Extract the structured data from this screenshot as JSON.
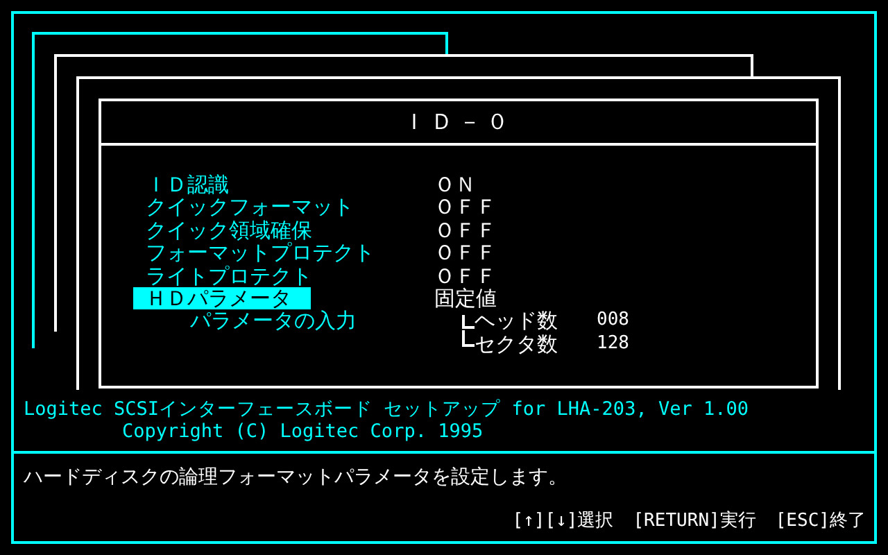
{
  "dialog": {
    "title": "ＩＤ－０",
    "settings": [
      {
        "label": "ＩＤ認識",
        "value": "ＯＮ",
        "selected": false
      },
      {
        "label": "クイックフォーマット",
        "value": "ＯＦＦ",
        "selected": false
      },
      {
        "label": "クイック領域確保",
        "value": "ＯＦＦ",
        "selected": false
      },
      {
        "label": "フォーマットプロテクト",
        "value": "ＯＦＦ",
        "selected": false
      },
      {
        "label": "ライトプロテクト",
        "value": "ＯＦＦ",
        "selected": false
      },
      {
        "label": "ＨＤパラメータ",
        "value": "固定値",
        "selected": true
      }
    ],
    "sub_item": "パラメータの入力",
    "parameters": [
      {
        "label": "ヘッド数",
        "value": "008"
      },
      {
        "label": "セクタ数",
        "value": "128"
      }
    ]
  },
  "product_line": "Logitec  SCSIインターフェースボード セットアップ for LHA-203, Ver 1.00",
  "copyright": "Copyright (C) Logitec Corp. 1995",
  "help_text": "ハードディスクの論理フォーマットパラメータを設定します。",
  "key_hints": [
    {
      "key": "[↑][↓]",
      "action": "選択"
    },
    {
      "key": "[RETURN]",
      "action": "実行"
    },
    {
      "key": "[ESC]",
      "action": "終了"
    }
  ]
}
